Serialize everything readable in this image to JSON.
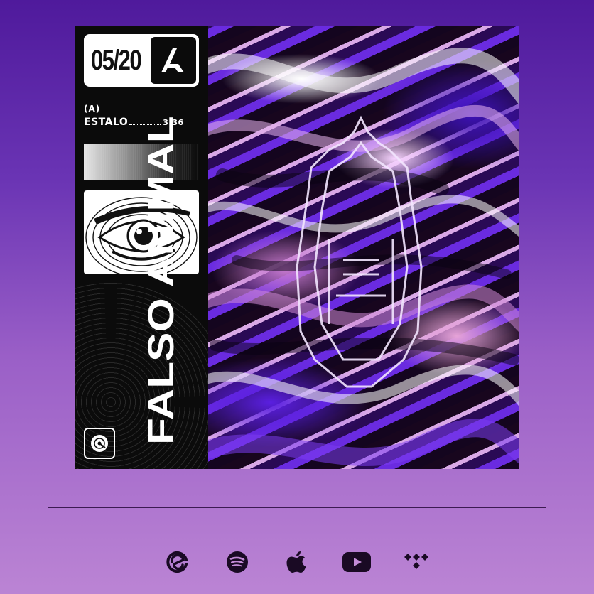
{
  "cover": {
    "release_number": "05/20",
    "side_label": "(A)",
    "track_title": "ESTALO",
    "track_duration": "3:36",
    "artist": "FALSO ANIMAL"
  },
  "links": [
    {
      "name": "Deezer-style",
      "icon": "deezer-icon"
    },
    {
      "name": "Spotify",
      "icon": "spotify-icon"
    },
    {
      "name": "Apple Music",
      "icon": "apple-icon"
    },
    {
      "name": "YouTube",
      "icon": "youtube-icon"
    },
    {
      "name": "Tidal",
      "icon": "tidal-icon"
    }
  ],
  "colors": {
    "bg_top": "#4f1a9c",
    "bg_bottom": "#bb84d4",
    "icon": "#1a0a24"
  }
}
